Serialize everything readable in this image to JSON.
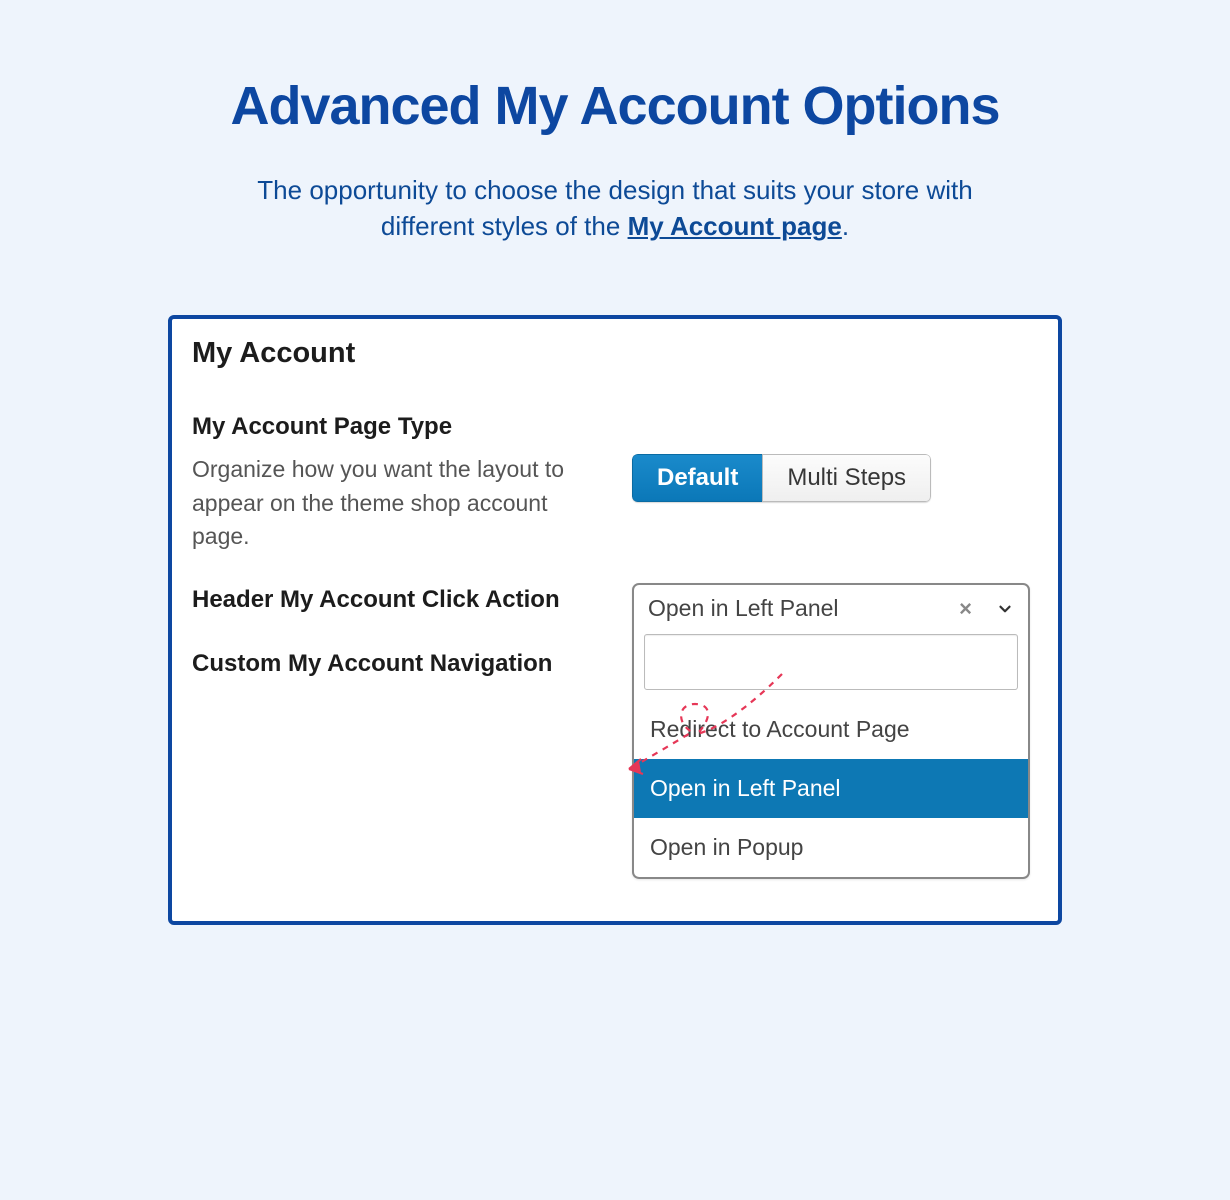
{
  "hero": {
    "title": "Advanced My Account Options",
    "sub_pre": "The opportunity to choose the design that suits your store with different styles of the ",
    "sub_link": "My Account page",
    "sub_post": "."
  },
  "panel": {
    "title": "My Account",
    "page_type": {
      "label": "My Account Page Type",
      "desc": "Organize how you want the layout to appear on the theme shop account page.",
      "options": [
        "Default",
        "Multi Steps"
      ],
      "active": "Default"
    },
    "click_action": {
      "label": "Header My Account Click Action",
      "selected": "Open in Left Panel",
      "options": [
        "Redirect to Account Page",
        "Open in Left Panel",
        "Open in Popup"
      ]
    },
    "custom_nav": {
      "label": "Custom My Account Navigation"
    }
  }
}
